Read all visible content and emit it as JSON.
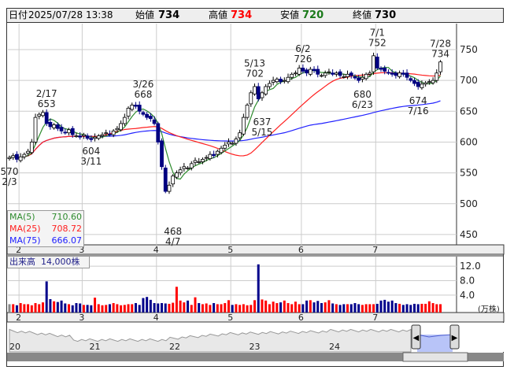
{
  "header": {
    "date_label": "日付",
    "datetime": "2025/07/28 13:38",
    "open_label": "始値",
    "open": "734",
    "high_label": "高値",
    "high": "734",
    "low_label": "安値",
    "low": "720",
    "close_label": "終値",
    "close": "730"
  },
  "colors": {
    "up_fill": "#ffffff",
    "down_fill": "#000080",
    "ma5": "#2e8b2e",
    "ma25": "#ff2020",
    "ma75": "#2020ff",
    "vol_up": "#ff0000",
    "vol_down": "#00008b",
    "vol_flat": "#888888"
  },
  "legend": {
    "ma5_label": "MA(5)",
    "ma5": "710.60",
    "ma25_label": "MA(25)",
    "ma25": "708.72",
    "ma75_label": "MA(75)",
    "ma75": "666.07"
  },
  "volume": {
    "label": "出来高",
    "value": "14,000株",
    "unit": "(万株)"
  },
  "navigator": {
    "years": [
      "20",
      "21",
      "22",
      "23",
      "24"
    ]
  },
  "chart_data": {
    "type": "candlestick",
    "price_ticks": [
      750,
      700,
      650,
      600,
      550,
      500,
      450
    ],
    "price_range": [
      435,
      775
    ],
    "volume_ticks": [
      "12.0",
      "8.0",
      "4.0"
    ],
    "months": [
      {
        "label": "2",
        "idx": 3
      },
      {
        "label": "3",
        "idx": 20
      },
      {
        "label": "4",
        "idx": 40
      },
      {
        "label": "5",
        "idx": 60
      },
      {
        "label": "6",
        "idx": 79
      },
      {
        "label": "7",
        "idx": 99
      }
    ],
    "closes": [
      575,
      578,
      572,
      576,
      580,
      585,
      600,
      640,
      645,
      648,
      630,
      625,
      628,
      622,
      618,
      615,
      620,
      612,
      610,
      608,
      612,
      606,
      604,
      608,
      610,
      612,
      615,
      612,
      618,
      622,
      630,
      640,
      655,
      660,
      658,
      650,
      645,
      640,
      638,
      630,
      600,
      560,
      520,
      530,
      545,
      550,
      555,
      560,
      558,
      565,
      570,
      568,
      572,
      575,
      580,
      578,
      585,
      590,
      595,
      600,
      598,
      605,
      615,
      640,
      660,
      680,
      690,
      670,
      680,
      690,
      695,
      700,
      702,
      698,
      700,
      705,
      710,
      712,
      720,
      715,
      712,
      718,
      716,
      710,
      708,
      712,
      714,
      710,
      712,
      708,
      706,
      710,
      708,
      704,
      700,
      705,
      710,
      712,
      740,
      720,
      718,
      715,
      712,
      710,
      708,
      712,
      710,
      705,
      700,
      695,
      690,
      694,
      696,
      698,
      700,
      712,
      730
    ],
    "volumes": [
      1.5,
      1.5,
      1.2,
      1.8,
      1.5,
      1.5,
      1.2,
      1.8,
      1.5,
      2.0,
      7.8,
      2.9,
      2.3,
      2.1,
      2.5,
      1.7,
      1.5,
      1.2,
      1.8,
      1.7,
      1.3,
      1.3,
      1.2,
      3.3,
      1.5,
      1.2,
      1.3,
      1.5,
      1.8,
      1.5,
      1.2,
      1.3,
      1.5,
      1.5,
      1.8,
      1.3,
      3.2,
      3.5,
      2.7,
      1.8,
      1.7,
      1.8,
      1.7,
      1.6,
      1.9,
      6.3,
      2.5,
      2.0,
      2.5,
      1.3,
      3.4,
      1.8,
      1.5,
      1.7,
      1.3,
      1.8,
      1.5,
      1.5,
      1.8,
      2.6,
      1.3,
      1.5,
      1.3,
      1.5,
      1.2,
      1.3,
      2.6,
      12.5,
      2.8,
      2.5,
      1.5,
      2.2,
      1.8,
      2.0,
      2.5,
      1.8,
      1.5,
      2.2,
      1.5,
      1.5,
      2.5,
      2.6,
      2.0,
      2.4,
      1.8,
      2.0,
      2.6,
      1.7,
      1.5,
      1.3,
      1.5,
      1.5,
      1.5,
      1.8,
      1.5,
      1.3,
      1.5,
      1.5,
      1.5,
      1.6,
      2.5,
      2.7,
      2.2,
      2.5,
      1.8,
      1.6,
      1.3,
      1.5,
      1.3,
      1.6,
      1.5,
      1.6,
      1.6,
      2.3,
      1.8,
      1.5,
      1.5,
      1.6,
      1.8,
      1.6,
      2.1
    ],
    "annotations": [
      {
        "idx": 0,
        "price": "570",
        "date": "2/3",
        "pos": "below",
        "at": 565
      },
      {
        "idx": 10,
        "price": "653",
        "date": "2/17",
        "pos": "above",
        "at": 653
      },
      {
        "idx": 22,
        "price": "604",
        "date": "3/11",
        "pos": "below",
        "at": 598
      },
      {
        "idx": 36,
        "price": "668",
        "date": "3/26",
        "pos": "above",
        "at": 668
      },
      {
        "idx": 44,
        "price": "468",
        "date": "4/7",
        "pos": "below",
        "at": 468
      },
      {
        "idx": 66,
        "price": "702",
        "date": "5/13",
        "pos": "above",
        "at": 702
      },
      {
        "idx": 68,
        "price": "637",
        "date": "5/15",
        "pos": "below",
        "at": 645
      },
      {
        "idx": 79,
        "price": "726",
        "date": "6/2",
        "pos": "above",
        "at": 726
      },
      {
        "idx": 95,
        "price": "680",
        "date": "6/23",
        "pos": "below",
        "at": 690
      },
      {
        "idx": 99,
        "price": "752",
        "date": "7/1",
        "pos": "above",
        "at": 752
      },
      {
        "idx": 110,
        "price": "674",
        "date": "7/16",
        "pos": "below",
        "at": 680
      },
      {
        "idx": 116,
        "price": "734",
        "date": "7/28",
        "pos": "above",
        "at": 734
      }
    ]
  }
}
